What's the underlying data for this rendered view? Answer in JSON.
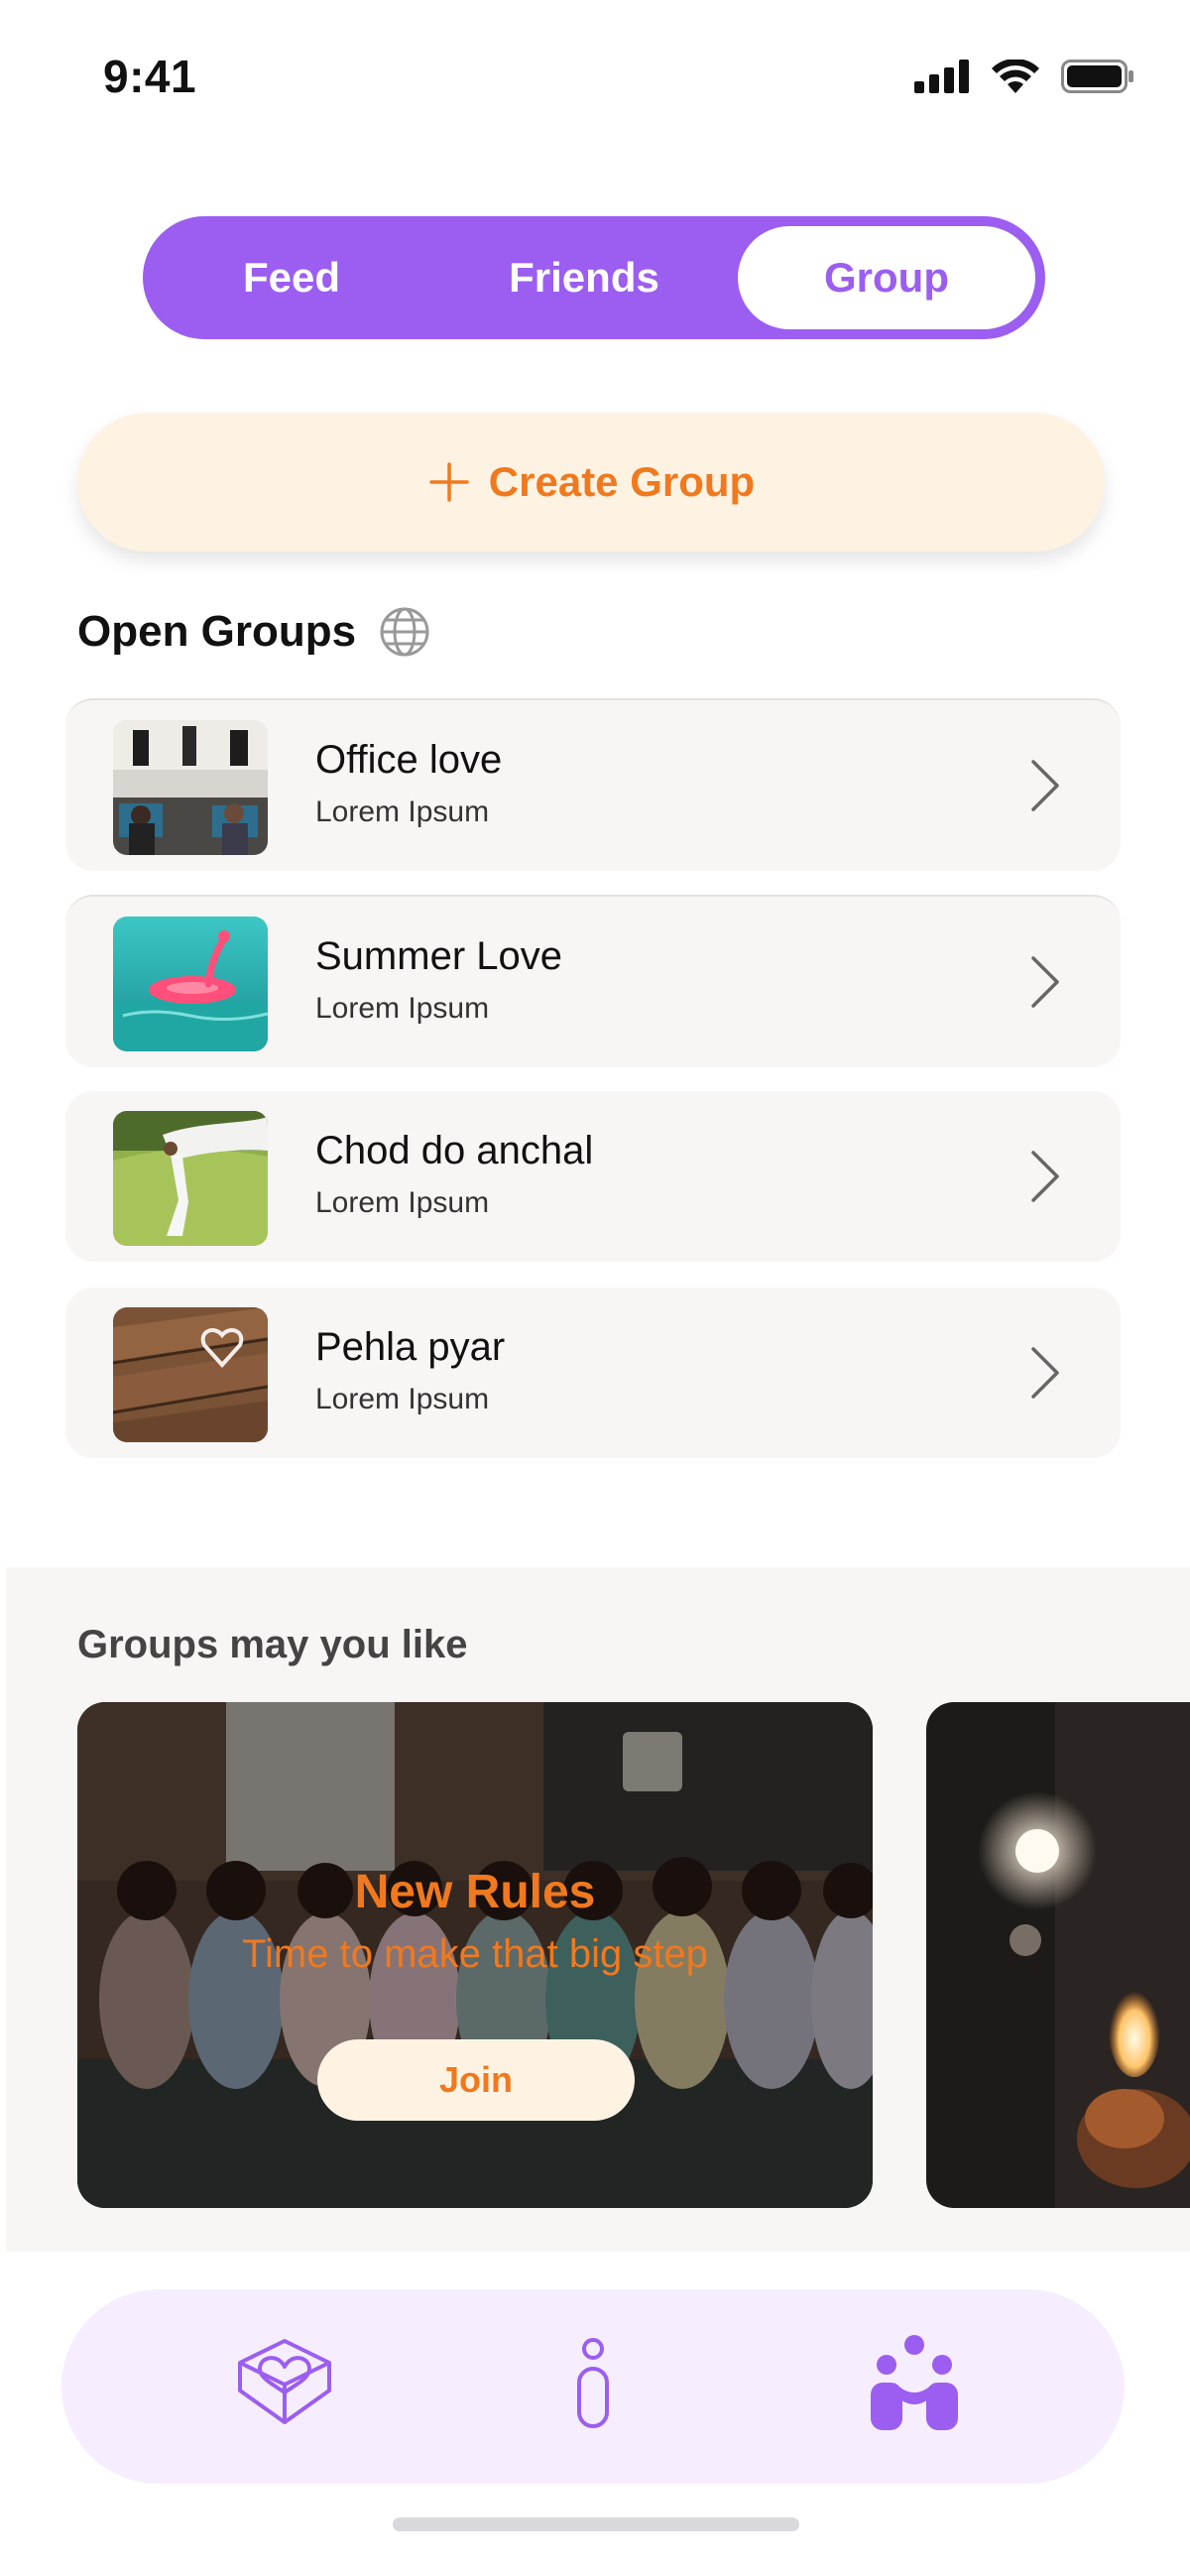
{
  "status_bar": {
    "time": "9:41"
  },
  "tabs": [
    {
      "label": "Feed",
      "active": false
    },
    {
      "label": "Friends",
      "active": false
    },
    {
      "label": "Group",
      "active": true
    }
  ],
  "create_group": {
    "label": "Create Group"
  },
  "open_groups": {
    "title": "Open Groups",
    "items": [
      {
        "title": "Office love",
        "subtitle": "Lorem Ipsum"
      },
      {
        "title": "Summer Love",
        "subtitle": "Lorem Ipsum"
      },
      {
        "title": "Chod do anchal",
        "subtitle": "Lorem Ipsum"
      },
      {
        "title": "Pehla pyar",
        "subtitle": "Lorem Ipsum"
      }
    ]
  },
  "groups_you_may_like": {
    "title": "Groups may you like",
    "cards": [
      {
        "title": "New Rules",
        "subtitle": "Time to make that big step",
        "button": "Join"
      }
    ]
  },
  "bottom_nav": [
    {
      "icon": "heart-box-icon",
      "active": false
    },
    {
      "icon": "person-icon",
      "active": false
    },
    {
      "icon": "group-icon",
      "active": true
    }
  ],
  "colors": {
    "accent_purple": "#9b5ef0",
    "accent_orange": "#f0791f",
    "cream": "#fef3e3",
    "nav_bg": "#f6eefe"
  }
}
